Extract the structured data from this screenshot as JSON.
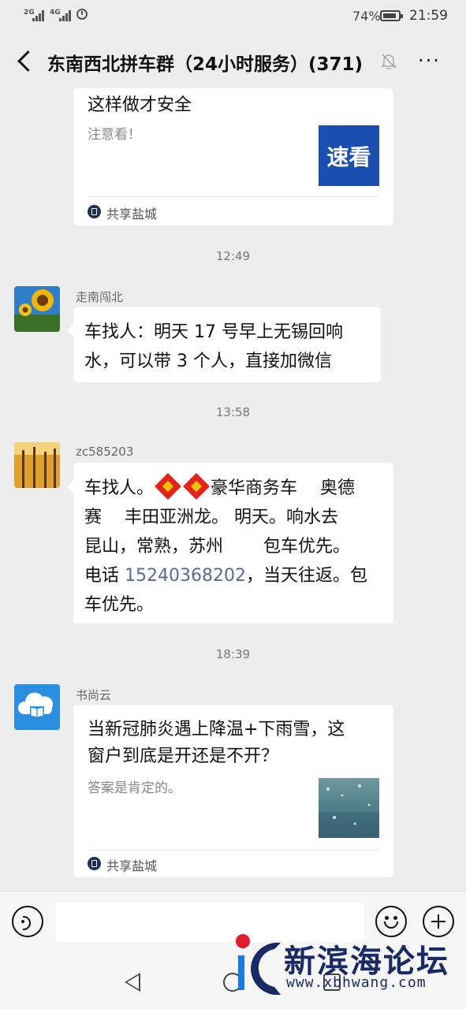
{
  "status_bar": {
    "sig1": "2G",
    "sig2": "4G",
    "battery_pct": "74%",
    "time": "21:59"
  },
  "header": {
    "title": "东南西北拼车群（24小时服务）(371)",
    "more": "···"
  },
  "messages": [
    {
      "type": "link_card",
      "title": "这样做才安全",
      "desc": "注意看！",
      "thumb_text": "速看",
      "source": "共享盐城"
    },
    {
      "type": "time",
      "text": "12:49"
    },
    {
      "type": "text",
      "sender": "走南闯北",
      "lines": [
        "车找人：明天 17 号早上无锡回响",
        "水，可以带 3 个人，直接加微信"
      ]
    },
    {
      "type": "time",
      "text": "13:58"
    },
    {
      "type": "text",
      "sender": "zc585203",
      "line1_pre": "车找人。",
      "line1_post": "豪华商务车　 奥德",
      "line2": "赛　 丰田亚洲龙。 明天。响水去",
      "line3": "昆山，常熟，苏州　　 包车优先。",
      "line4_pre": "电话 ",
      "phone": "15240368202",
      "line4_post": "，当天往返。包",
      "line5": "车优先。"
    },
    {
      "type": "time",
      "text": "18:39"
    },
    {
      "type": "link_card",
      "sender": "书尚云",
      "title_lines": [
        "当新冠肺炎遇上降温+下雨雪，这",
        "窗户到底是开还是不开？"
      ],
      "desc": "答案是肯定的。",
      "source": "共享盐城"
    }
  ],
  "watermark": {
    "title": "新滨海论坛",
    "url": "www.xbhwang.com"
  },
  "colors": {
    "background": "#ededed",
    "link": "#576b95",
    "thumb_blue": "#1a4fb0",
    "watermark": "#1a2a66"
  }
}
